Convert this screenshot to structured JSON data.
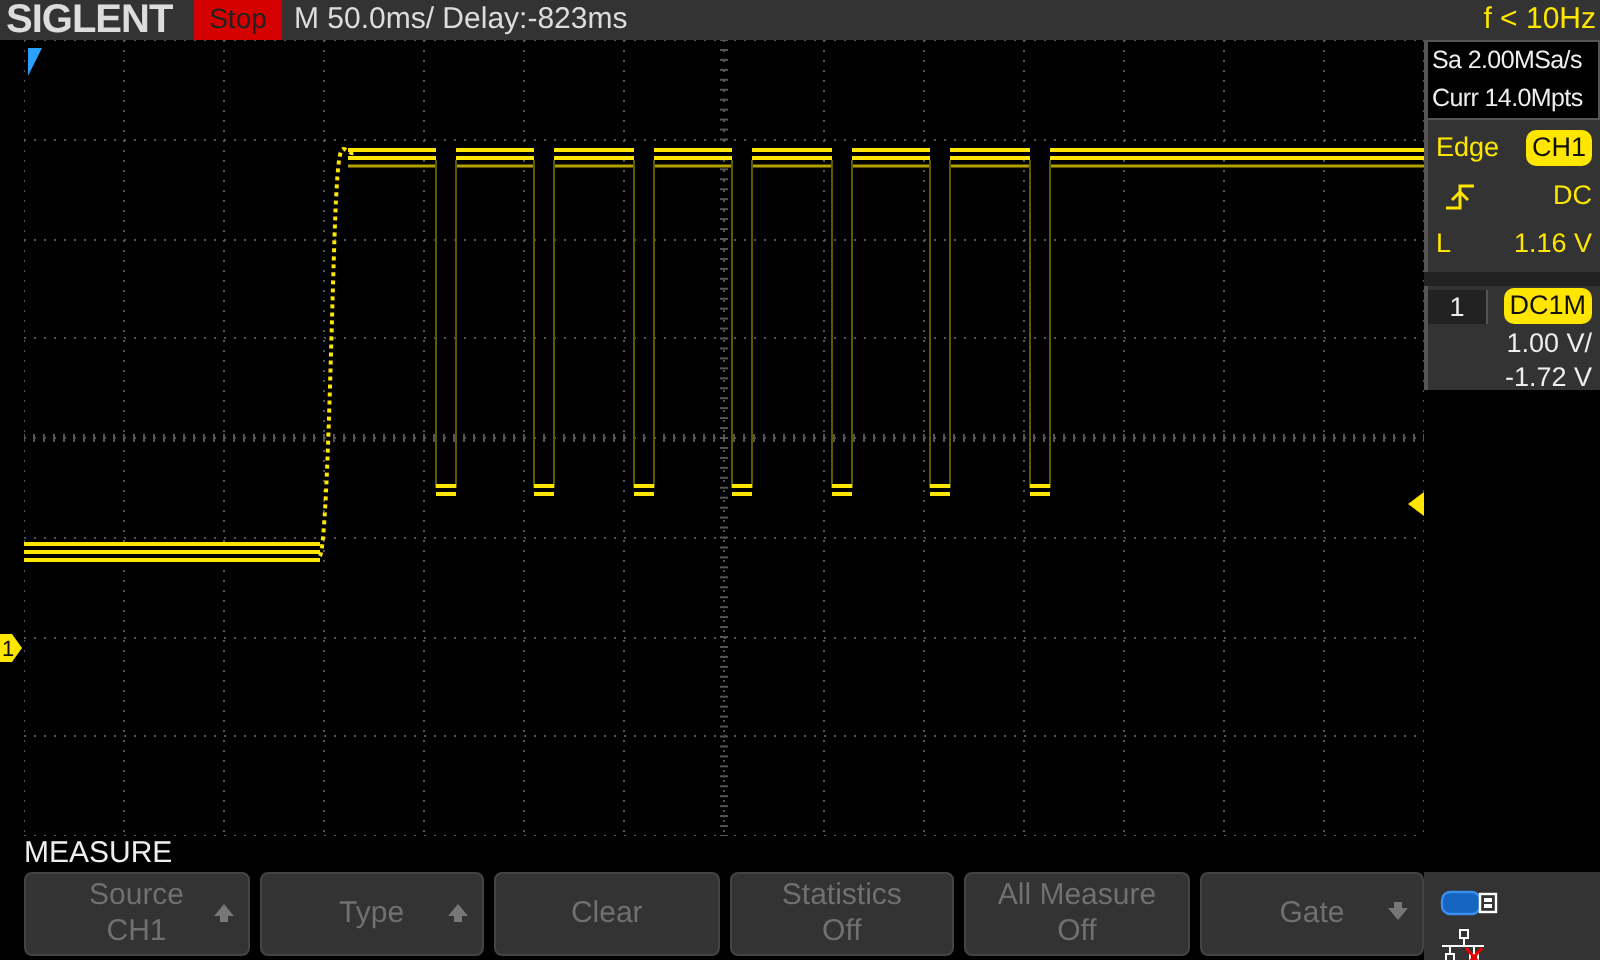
{
  "header": {
    "logo": "SIGLENT",
    "run_state": "Stop",
    "timebase": "M 50.0ms/ Delay:-823ms",
    "trigger_frequency": "f < 10Hz"
  },
  "acquisition": {
    "sample_rate": "Sa 2.00MSa/s",
    "memory_depth": "Curr 14.0Mpts"
  },
  "trigger": {
    "type": "Edge",
    "source": "CH1",
    "coupling": "DC",
    "level_label": "L",
    "level_value": "1.16 V"
  },
  "channel": {
    "number": "1",
    "coupling": "DC1M",
    "scale": "1.00 V/",
    "offset": "-1.72 V"
  },
  "channel_marker": "1",
  "menu": {
    "title": "MEASURE",
    "buttons": [
      {
        "label": "Source",
        "value": "CH1",
        "kind": "up"
      },
      {
        "label": "Type",
        "kind": "up"
      },
      {
        "label": "Clear",
        "kind": "plain"
      },
      {
        "label": "Statistics",
        "value": "Off",
        "kind": "plain"
      },
      {
        "label": "All Measure",
        "value": "Off",
        "kind": "plain"
      },
      {
        "label": "Gate",
        "kind": "down"
      }
    ]
  }
}
